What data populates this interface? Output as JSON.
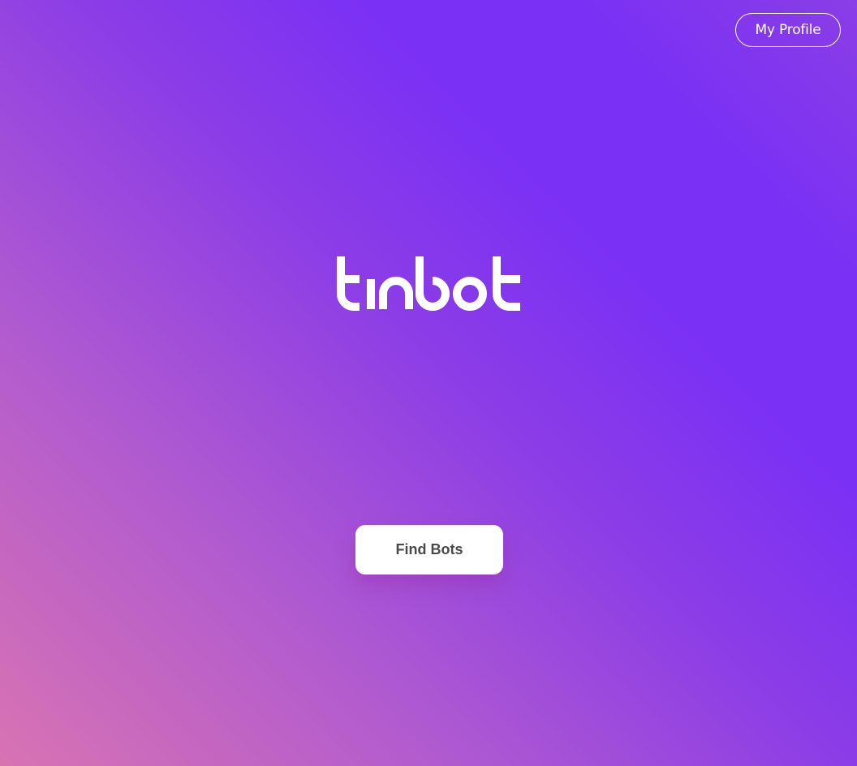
{
  "header": {
    "profile_label": "My Profile"
  },
  "brand": {
    "logo_text": "tinbot",
    "logo_color": "#ffffff"
  },
  "main": {
    "find_bots_label": "Find Bots"
  },
  "colors": {
    "gradient_start": "#d873b2",
    "gradient_mid": "#8c3de6",
    "gradient_end": "#7a30f5",
    "button_bg": "#ffffff",
    "button_text": "#4a4a4a"
  }
}
